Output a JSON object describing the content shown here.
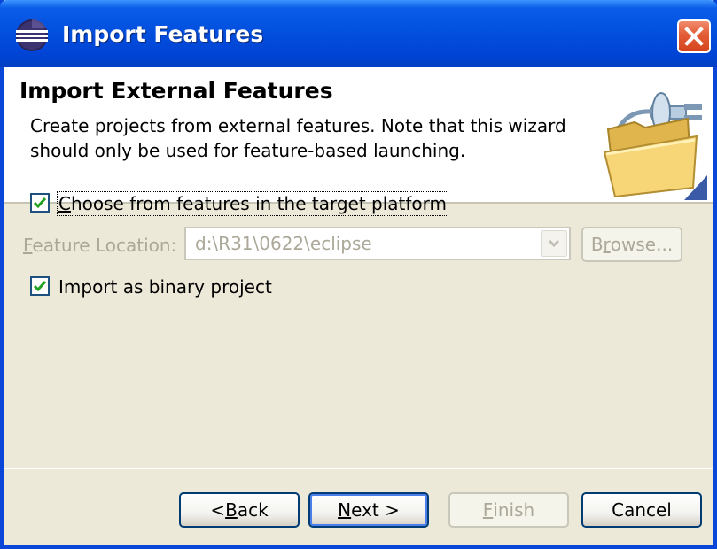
{
  "window": {
    "title": "Import Features"
  },
  "header": {
    "title": "Import External Features",
    "description": "Create projects from external features. Note that this wizard should only be used for feature-based launching."
  },
  "options": {
    "choose_from_target": {
      "label": "Choose from features in the target platform",
      "mnemonic_char": "C",
      "rest": "hoose from features in the target platform",
      "checked": true
    },
    "import_binary": {
      "label": "Import as binary project",
      "checked": true
    }
  },
  "feature_location": {
    "label_mnemonic": "F",
    "label_rest": "eature Location:",
    "value": "d:\\R31\\0622\\eclipse",
    "enabled": false
  },
  "buttons": {
    "browse": {
      "pre": "B",
      "mn": "r",
      "post": "owse...",
      "enabled": false
    },
    "back": {
      "pre": "< ",
      "mn": "B",
      "post": "ack",
      "enabled": true
    },
    "next": {
      "pre": "",
      "mn": "N",
      "post": "ext >",
      "enabled": true
    },
    "finish": {
      "pre": "",
      "mn": "F",
      "post": "inish",
      "enabled": false
    },
    "cancel": {
      "label": "Cancel",
      "enabled": true
    }
  },
  "colors": {
    "titlebar": "#0452e0",
    "close": "#e25c35",
    "dialog_bg": "#ece9d8",
    "checkbox_check": "#21a121"
  },
  "icons": {
    "app": "eclipse-icon",
    "close": "close-icon",
    "wizard": "folder-plug-icon",
    "combo": "chevron-down-icon"
  }
}
